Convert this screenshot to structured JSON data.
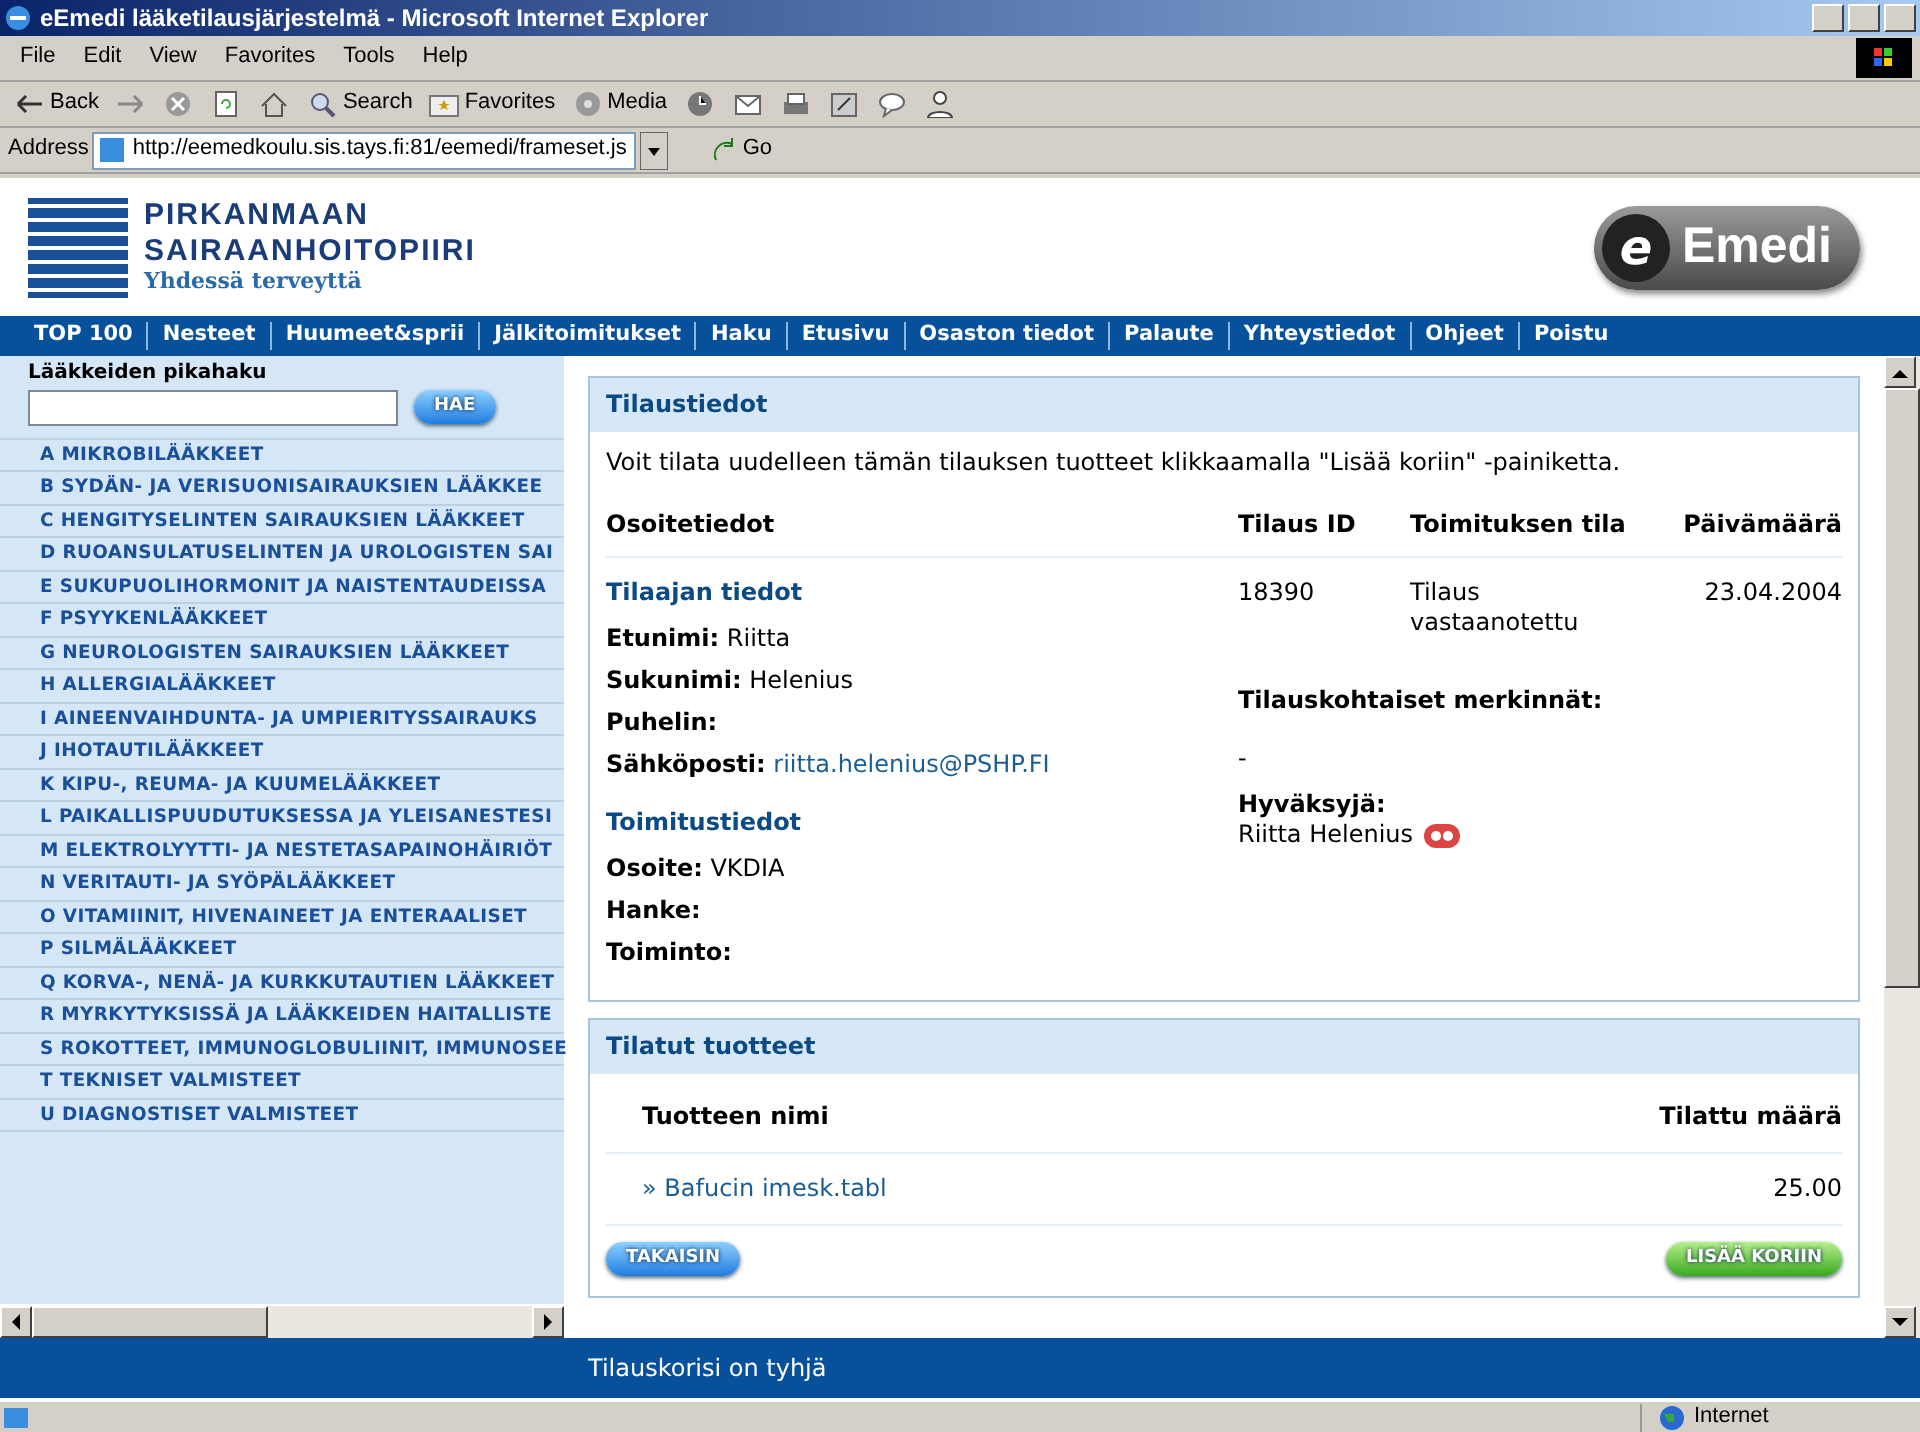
{
  "window": {
    "title": "eEmedi lääketilausjärjestelmä - Microsoft Internet Explorer"
  },
  "menu": [
    "File",
    "Edit",
    "View",
    "Favorites",
    "Tools",
    "Help"
  ],
  "toolbar": [
    {
      "kind": "back",
      "label": "Back"
    },
    {
      "kind": "forward"
    },
    {
      "kind": "stop"
    },
    {
      "kind": "refresh"
    },
    {
      "kind": "home"
    },
    {
      "kind": "search",
      "label": "Search"
    },
    {
      "kind": "favorites",
      "label": "Favorites"
    },
    {
      "kind": "media",
      "label": "Media"
    },
    {
      "kind": "history"
    },
    {
      "kind": "mail"
    },
    {
      "kind": "print"
    },
    {
      "kind": "edit"
    },
    {
      "kind": "discuss"
    },
    {
      "kind": "messenger"
    }
  ],
  "address": {
    "label": "Address",
    "value": "http://eemedkoulu.sis.tays.fi:81/eemedi/frameset.js",
    "go": "Go"
  },
  "header": {
    "org_line1": "PIRKANMAAN",
    "org_line2": "SAIRAANHOITOPIIRI",
    "slogan": "Yhdessä terveyttä",
    "brand_mark": "e",
    "brand": "Emedi"
  },
  "nav": [
    "TOP 100",
    "Nesteet",
    "Huumeet&sprii",
    "Jälkitoimitukset",
    "Haku",
    "Etusivu",
    "Osaston tiedot",
    "Palaute",
    "Yhteystiedot",
    "Ohjeet",
    "Poistu"
  ],
  "quick_search": {
    "label": "Lääkkeiden pikahaku",
    "button": "HAE"
  },
  "categories": [
    "A MIKROBILÄÄKKEET",
    "B SYDÄN- JA VERISUONISAIRAUKSIEN LÄÄKKEE",
    "C HENGITYSELINTEN SAIRAUKSIEN LÄÄKKEET",
    "D RUOANSULATUSELINTEN JA UROLOGISTEN SAI",
    "E SUKUPUOLIHORMONIT JA NAISTENTAUDEISSA",
    "F PSYYKENLÄÄKKEET",
    "G NEUROLOGISTEN SAIRAUKSIEN LÄÄKKEET",
    "H ALLERGIALÄÄKKEET",
    "I AINEENVAIHDUNTA- JA UMPIERITYSSAIRAUKS",
    "J IHOTAUTILÄÄKKEET",
    "K KIPU-, REUMA- JA KUUMELÄÄKKEET",
    "L PAIKALLISPUUDUTUKSESSA JA YLEISANESTESI",
    "M ELEKTROLYYTTI- JA NESTETASAPAINOHÄIRIÖT",
    "N VERITAUTI- JA SYÖPÄLÄÄKKEET",
    "O VITAMIINIT, HIVENAINEET JA ENTERAALISET",
    "P SILMÄLÄÄKKEET",
    "Q KORVA-, NENÄ- JA KURKKUTAUTIEN LÄÄKKEET",
    "R MYRKYTYKSISSÄ JA LÄÄKKEIDEN HAITALLISTE",
    "S ROKOTTEET, IMMUNOGLOBULIINIT, IMMUNOSEE",
    "T TEKNISET VALMISTEET",
    "U DIAGNOSTISET VALMISTEET"
  ],
  "order_panel": {
    "title": "Tilaustiedot",
    "intro": "Voit tilata uudelleen tämän tilauksen tuotteet klikkaamalla \"Lisää koriin\" -painiketta.",
    "columns": [
      "Osoitetiedot",
      "Tilaus ID",
      "Toimituksen tila",
      "Päivämäärä"
    ],
    "customer_title": "Tilaajan tiedot",
    "customer_fields": [
      {
        "label": "Etunimi:",
        "value": "Riitta",
        "link": false
      },
      {
        "label": "Sukunimi:",
        "value": "Helenius",
        "link": false
      },
      {
        "label": "Puhelin:"
      },
      {
        "label": "Sähköposti:",
        "value": "riitta.helenius@PSHP.FI",
        "link": true
      }
    ],
    "delivery_title": "Toimitustiedot",
    "delivery_fields": [
      {
        "label": "Osoite:",
        "value": "VKDIA"
      },
      {
        "label": "Hanke:"
      },
      {
        "label": "Toiminto:"
      }
    ],
    "order_id": "18390",
    "status": "Tilaus vastaanotettu",
    "date": "23.04.2004",
    "notes_label": "Tilauskohtaiset merkinnät:",
    "notes": "-",
    "approver_label": "Hyväksyjä:",
    "approver": "Riitta Helenius"
  },
  "products_panel": {
    "title": "Tilatut tuotteet",
    "columns": [
      "Tuotteen nimi",
      "Tilattu määrä"
    ],
    "rows": [
      {
        "marker": "»",
        "name": "Bafucin imesk.tabl",
        "quantity": "25.00"
      }
    ],
    "back_button": "TAKAISIN",
    "add_button": "LISÄÄ KORIIN"
  },
  "footer": {
    "cart": "Tilauskorisi on tyhjä"
  },
  "status_bar": {
    "zone": "Internet"
  }
}
